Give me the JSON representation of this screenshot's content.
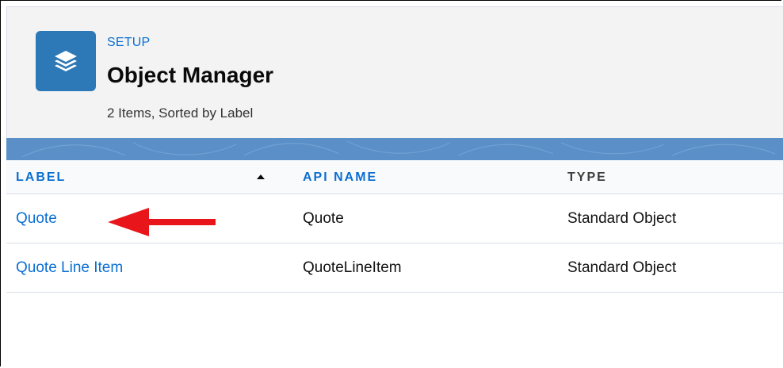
{
  "header": {
    "breadcrumb": "SETUP",
    "title": "Object Manager",
    "item_count": "2 Items, Sorted by Label",
    "icon": "layers-icon"
  },
  "table": {
    "columns": [
      {
        "label": "LABEL",
        "sorted": "ascending"
      },
      {
        "label": "API NAME"
      },
      {
        "label": "TYPE"
      }
    ],
    "rows": [
      {
        "label": "Quote",
        "api_name": "Quote",
        "type": "Standard Object"
      },
      {
        "label": "Quote Line Item",
        "api_name": "QuoteLineItem",
        "type": "Standard Object"
      }
    ]
  },
  "annotation": {
    "icon": "left-arrow-icon",
    "color": "#e8161b"
  },
  "colors": {
    "brand_icon": "#2d78b6",
    "link": "#0b6fd2",
    "banner": "#5a8fc8"
  }
}
